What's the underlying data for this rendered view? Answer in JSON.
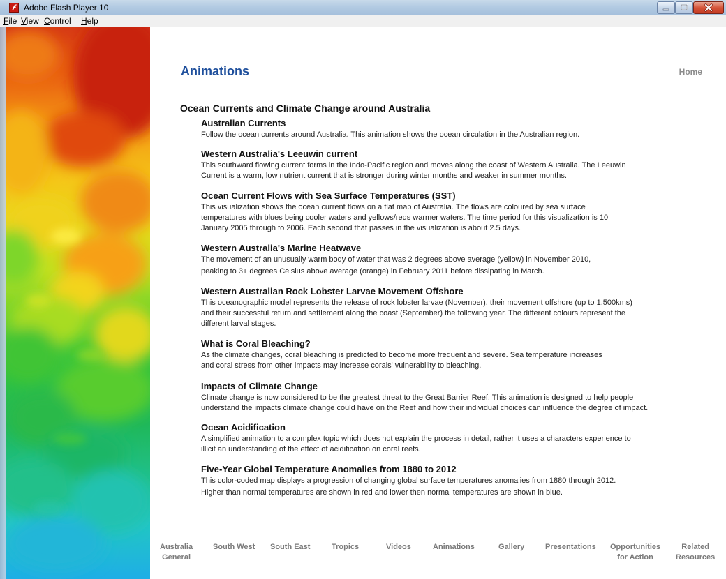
{
  "window": {
    "title": "Adobe Flash Player 10"
  },
  "menu": [
    "File",
    "View",
    "Control",
    "Help"
  ],
  "page": {
    "title": "Animations",
    "home_link": "Home",
    "section_heading": "Ocean Currents and Climate Change around Australia"
  },
  "items": [
    {
      "title": "Australian Currents",
      "desc": [
        "Follow the ocean currents around Australia. This animation shows the ocean circulation in the Australian region."
      ]
    },
    {
      "title": "Western Australia's Leeuwin current",
      "desc": [
        "This southward flowing current forms in the Indo-Pacific region and moves along the coast of Western Australia. The Leeuwin",
        "Current is a warm, low nutrient current that is stronger during winter months and weaker in summer months."
      ]
    },
    {
      "title": "Ocean Current Flows with Sea Surface Temperatures (SST)",
      "desc": [
        "This visualization shows the ocean current flows on a flat map of Australia. The flows are coloured by sea surface",
        "temperatures with blues being cooler waters and yellows/reds warmer waters. The time period for this visualization is 10",
        "January 2005 through to 2006. Each second that passes in the visualization is about 2.5 days."
      ]
    },
    {
      "title": "Western Australia's Marine Heatwave",
      "desc": [
        "The movement of an unusually warm body of water that was 2 degrees above average (yellow) in November 2010,",
        "peaking to 3+ degrees Celsius above average (orange) in February 2011 before dissipating in March."
      ]
    },
    {
      "title": "Western Australian Rock Lobster Larvae Movement Offshore",
      "desc": [
        "This oceanographic model represents the release of rock lobster larvae (November), their movement offshore (up to 1,500kms)",
        "and their successful return and settlement along the coast (September) the following year. The different colours represent the",
        "different larval stages."
      ]
    },
    {
      "title": "What is Coral Bleaching?",
      "desc": [
        "As the climate changes, coral bleaching is predicted to become more frequent and severe. Sea temperature increases",
        "and coral stress from other impacts may increase corals' vulnerability to bleaching."
      ]
    },
    {
      "title": "Impacts of Climate Change",
      "desc": [
        "Climate change is now considered to be the greatest threat to the Great Barrier Reef. This animation is designed to help people",
        "understand the impacts climate change could have on the Reef and how their individual choices can influence the degree of impact."
      ]
    },
    {
      "title": "Ocean Acidification",
      "desc": [
        "A simplified animation to a complex topic which does not explain the process in detail, rather it uses a characters experience to",
        "illicit an understanding of the effect of acidification on coral reefs."
      ]
    },
    {
      "title": "Five-Year Global Temperature Anomalies from 1880 to 2012",
      "desc": [
        "This color-coded map displays a progression of changing global surface temperatures anomalies from 1880 through 2012.",
        "Higher than normal temperatures are shown in red and lower then normal temperatures are shown in blue."
      ]
    }
  ],
  "nav": [
    [
      "Australia",
      "General"
    ],
    [
      "South West"
    ],
    [
      "South East"
    ],
    [
      "Tropics"
    ],
    [
      "Videos"
    ],
    [
      "Animations"
    ],
    [
      "Gallery"
    ],
    [
      "Presentations"
    ],
    [
      "Opportunities",
      "for Action"
    ],
    [
      "Related",
      "Resources"
    ]
  ],
  "icons": {
    "app": "flash-player-icon",
    "minimize": "minimize-icon",
    "maximize": "maximize-icon",
    "close": "close-icon"
  },
  "colors": {
    "title_blue": "#1e4f9c",
    "nav_grey": "#7a7a7a",
    "home_grey": "#8c8c8c"
  }
}
